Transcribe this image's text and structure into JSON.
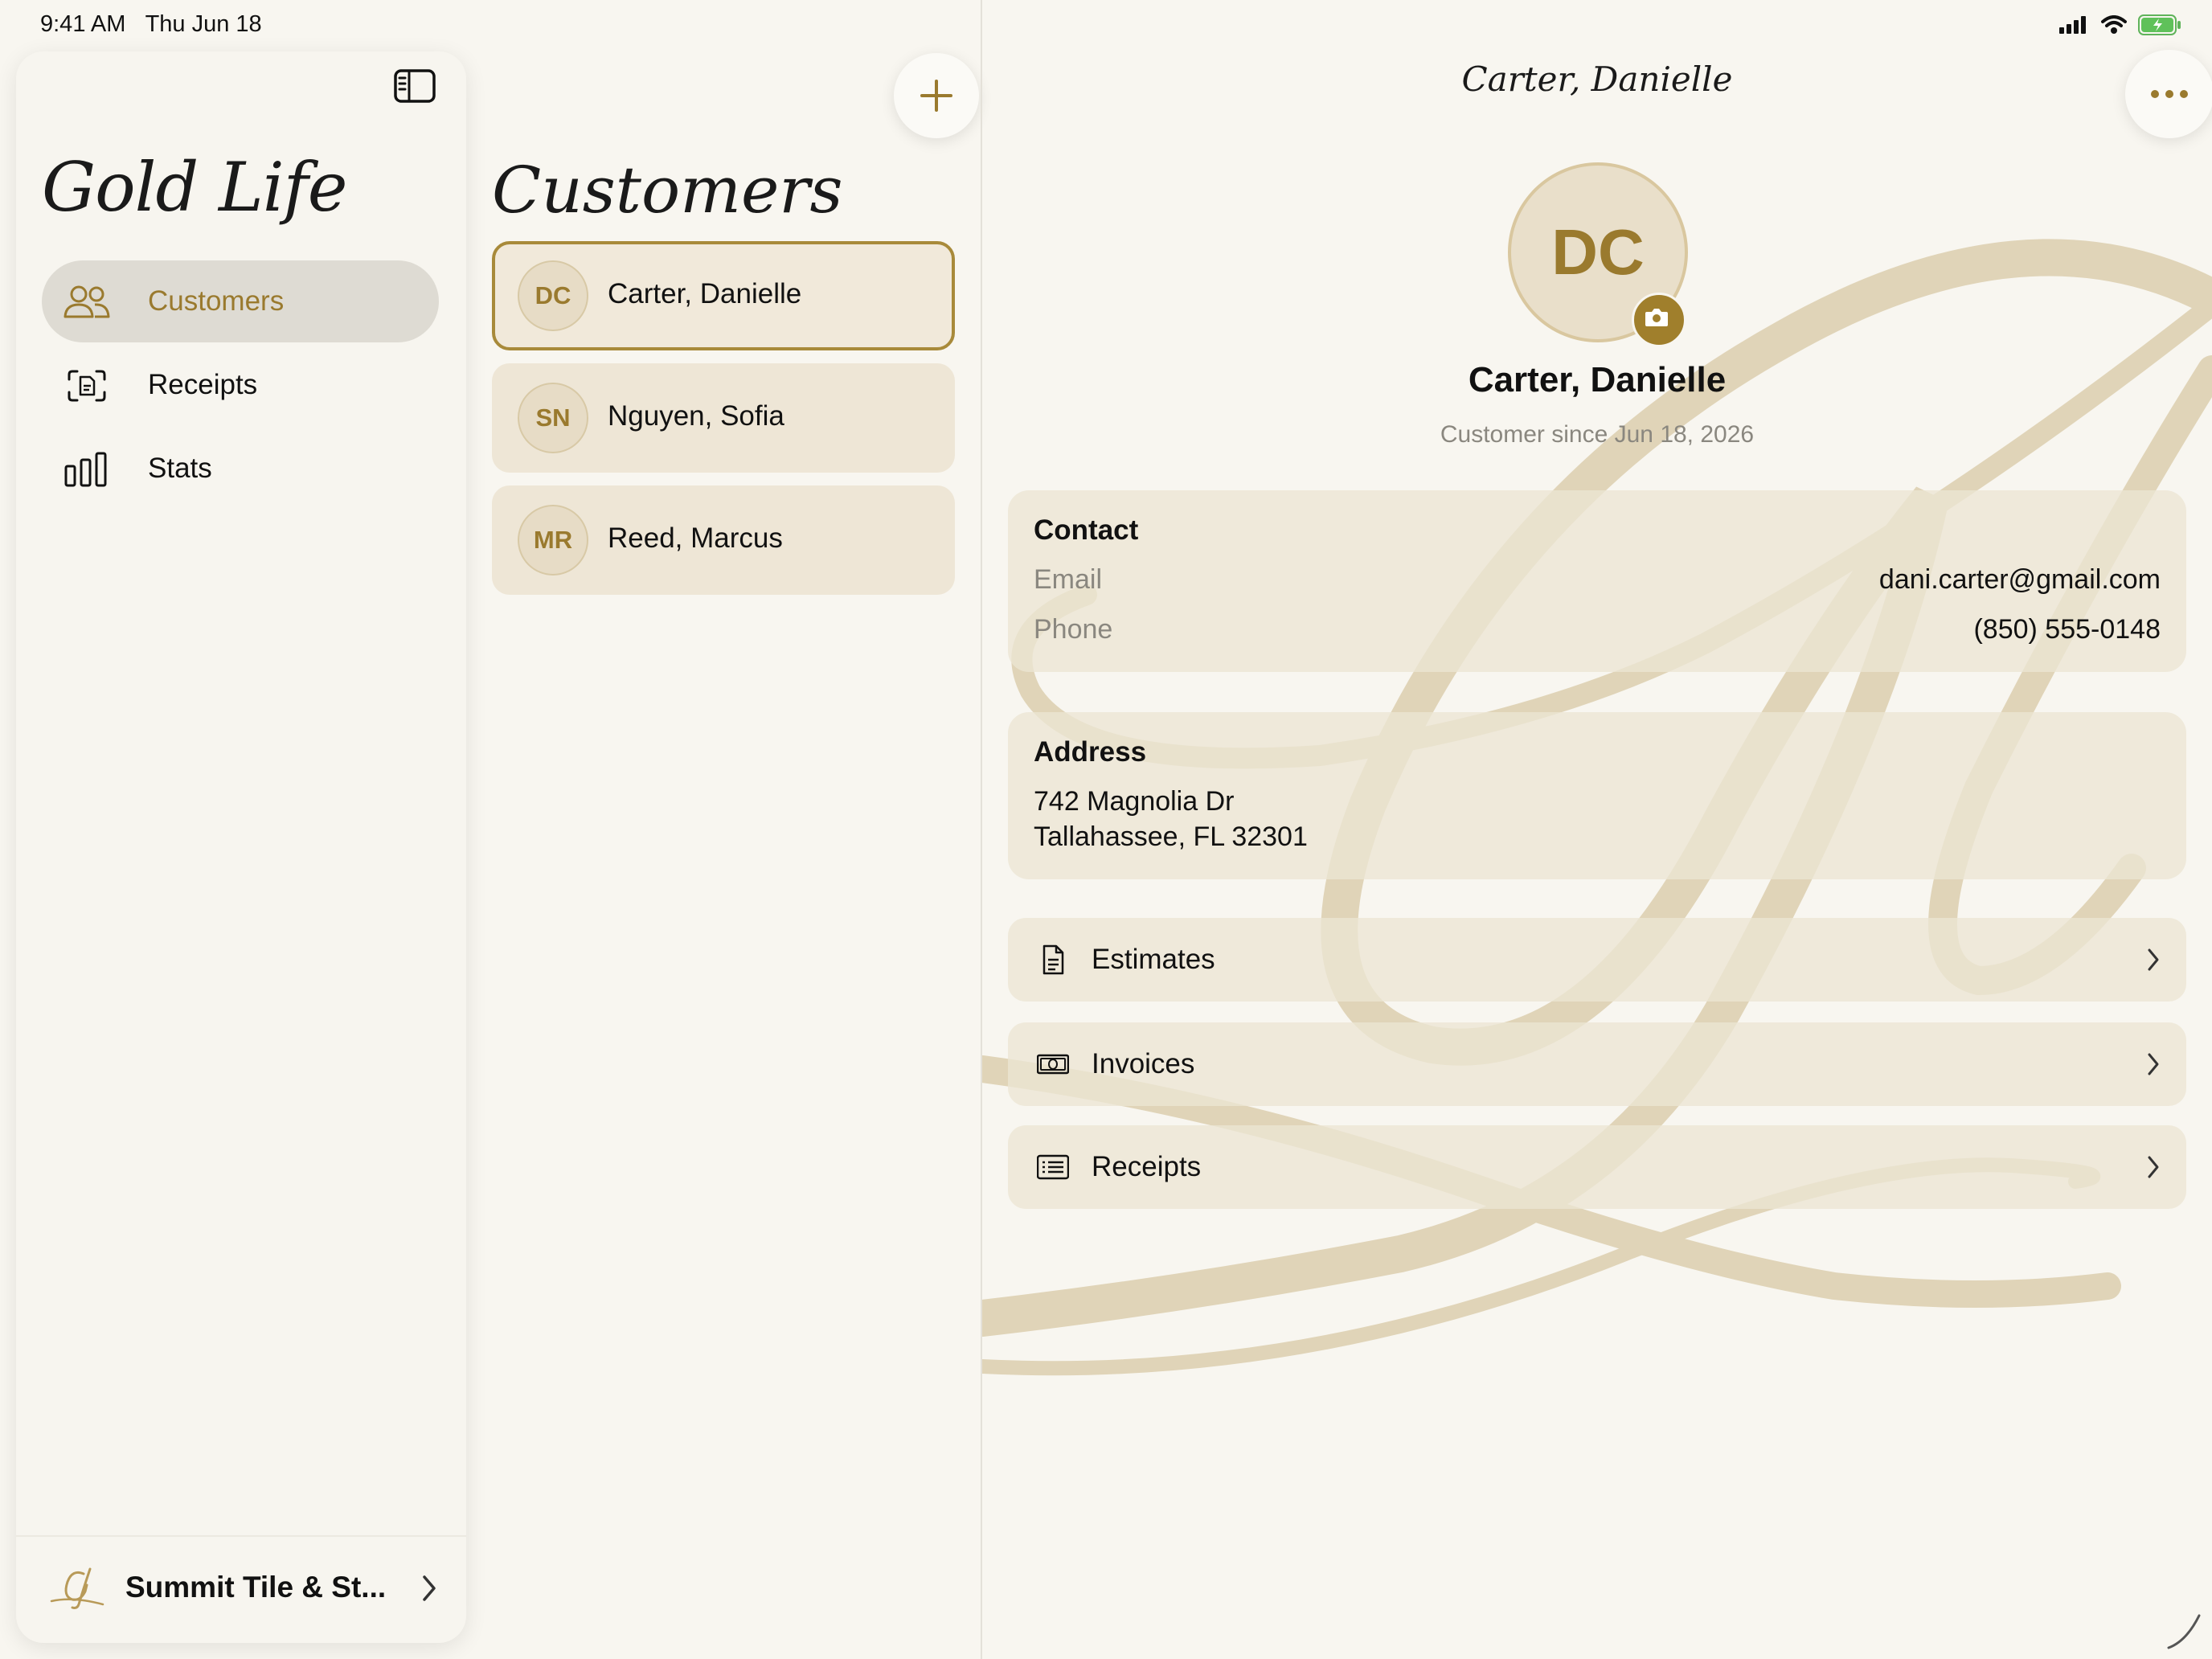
{
  "status_bar": {
    "time": "9:41 AM",
    "date": "Thu Jun 18"
  },
  "theme": {
    "accent": "#9a7a2e",
    "background": "#f8f6f0",
    "card": "#eee6d6",
    "selected_border": "#a88a3a"
  },
  "sidebar": {
    "brand": "Gold Life",
    "items": [
      {
        "label": "Customers",
        "icon": "people-icon",
        "active": true
      },
      {
        "label": "Receipts",
        "icon": "receipt-scan-icon",
        "active": false
      },
      {
        "label": "Stats",
        "icon": "bar-chart-icon",
        "active": false
      }
    ],
    "footer": {
      "label": "Summit Tile & St...",
      "logo": "gold-life-monogram-logo"
    }
  },
  "list": {
    "title": "Customers",
    "customers": [
      {
        "initials": "DC",
        "name": "Carter, Danielle",
        "selected": true
      },
      {
        "initials": "SN",
        "name": "Nguyen, Sofia",
        "selected": false
      },
      {
        "initials": "MR",
        "name": "Reed, Marcus",
        "selected": false
      }
    ]
  },
  "detail": {
    "nav_title": "Carter, Danielle",
    "initials": "DC",
    "name": "Carter, Danielle",
    "since": "Customer since Jun 18, 2026",
    "contact": {
      "heading": "Contact",
      "email_label": "Email",
      "email": "dani.carter@gmail.com",
      "phone_label": "Phone",
      "phone": "(850) 555-0148"
    },
    "address": {
      "heading": "Address",
      "line1": "742 Magnolia Dr",
      "line2": "Tallahassee, FL 32301"
    },
    "links": [
      {
        "label": "Estimates",
        "icon": "document-icon"
      },
      {
        "label": "Invoices",
        "icon": "banknote-icon"
      },
      {
        "label": "Receipts",
        "icon": "list-receipt-icon"
      }
    ]
  }
}
